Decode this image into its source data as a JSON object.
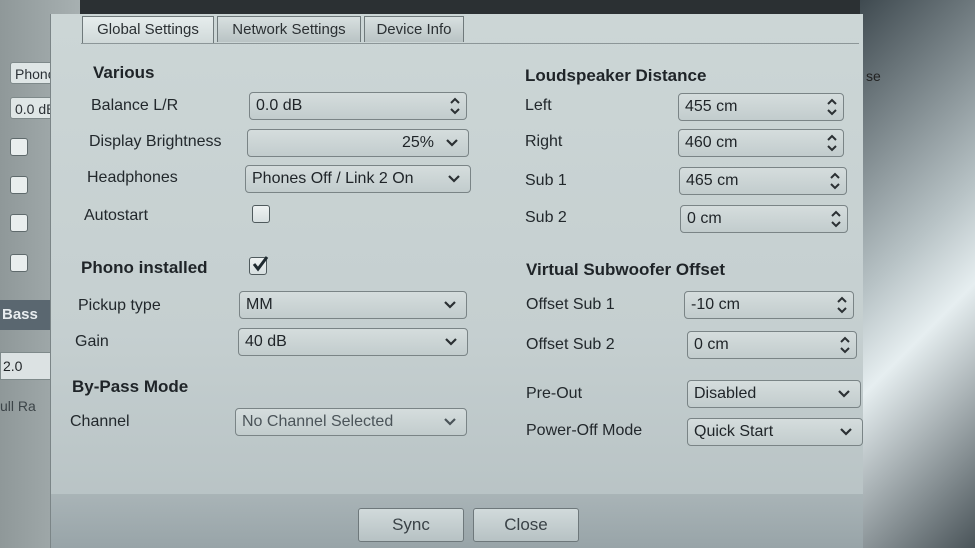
{
  "background": {
    "phono_chip": "Phono",
    "db_chip": "0.0 dB",
    "bass_label": "Bass",
    "num_value": "2.0",
    "partial_text": "ull Ra",
    "right_partial": "se"
  },
  "tabs": [
    {
      "label": "Global Settings",
      "active": true
    },
    {
      "label": "Network Settings",
      "active": false
    },
    {
      "label": "Device Info",
      "active": false
    }
  ],
  "various": {
    "title": "Various",
    "balance": {
      "label": "Balance L/R",
      "value": "0.0 dB"
    },
    "brightness": {
      "label": "Display Brightness",
      "value": "25%"
    },
    "headphones": {
      "label": "Headphones",
      "value": "Phones Off / Link 2 On"
    },
    "autostart": {
      "label": "Autostart",
      "checked": false
    }
  },
  "phono": {
    "title": "Phono installed",
    "checked": true,
    "pickup": {
      "label": "Pickup type",
      "value": "MM"
    },
    "gain": {
      "label": "Gain",
      "value": "40 dB"
    }
  },
  "bypass": {
    "title": "By-Pass Mode",
    "channel": {
      "label": "Channel",
      "value": "No Channel Selected"
    }
  },
  "distance": {
    "title": "Loudspeaker Distance",
    "left": {
      "label": "Left",
      "value": "455 cm"
    },
    "right": {
      "label": "Right",
      "value": "460 cm"
    },
    "sub1": {
      "label": "Sub 1",
      "value": "465 cm"
    },
    "sub2": {
      "label": "Sub 2",
      "value": "0 cm"
    }
  },
  "offset": {
    "title": "Virtual Subwoofer Offset",
    "sub1": {
      "label": "Offset Sub 1",
      "value": "-10 cm"
    },
    "sub2": {
      "label": "Offset Sub 2",
      "value": "0 cm"
    }
  },
  "preout": {
    "label": "Pre-Out",
    "value": "Disabled"
  },
  "poweroff": {
    "label": "Power-Off Mode",
    "value": "Quick Start"
  },
  "buttons": {
    "sync": "Sync",
    "close": "Close"
  }
}
